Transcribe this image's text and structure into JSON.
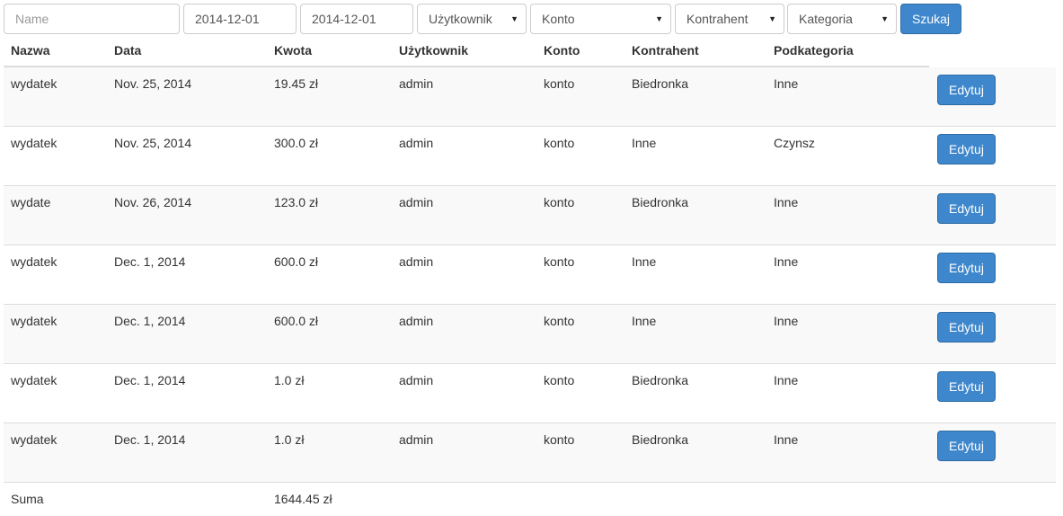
{
  "filters": {
    "name_placeholder": "Name",
    "date_from": "2014-12-01",
    "date_to": "2014-12-01",
    "user_select": "Użytkownik",
    "account_select": "Konto",
    "contractor_select": "Kontrahent",
    "category_select": "Kategoria",
    "search_label": "Szukaj"
  },
  "table": {
    "headers": [
      "Nazwa",
      "Data",
      "Kwota",
      "Użytkownik",
      "Konto",
      "Kontrahent",
      "Podkategoria"
    ],
    "edit_label": "Edytuj",
    "rows": [
      {
        "nazwa": "wydatek",
        "data": "Nov. 25, 2014",
        "kwota": "19.45 zł",
        "uzytkownik": "admin",
        "konto": "konto",
        "kontrahent": "Biedronka",
        "podkategoria": "Inne"
      },
      {
        "nazwa": "wydatek",
        "data": "Nov. 25, 2014",
        "kwota": "300.0 zł",
        "uzytkownik": "admin",
        "konto": "konto",
        "kontrahent": "Inne",
        "podkategoria": "Czynsz"
      },
      {
        "nazwa": "wydate",
        "data": "Nov. 26, 2014",
        "kwota": "123.0 zł",
        "uzytkownik": "admin",
        "konto": "konto",
        "kontrahent": "Biedronka",
        "podkategoria": "Inne"
      },
      {
        "nazwa": "wydatek",
        "data": "Dec. 1, 2014",
        "kwota": "600.0 zł",
        "uzytkownik": "admin",
        "konto": "konto",
        "kontrahent": "Inne",
        "podkategoria": "Inne"
      },
      {
        "nazwa": "wydatek",
        "data": "Dec. 1, 2014",
        "kwota": "600.0 zł",
        "uzytkownik": "admin",
        "konto": "konto",
        "kontrahent": "Inne",
        "podkategoria": "Inne"
      },
      {
        "nazwa": "wydatek",
        "data": "Dec. 1, 2014",
        "kwota": "1.0 zł",
        "uzytkownik": "admin",
        "konto": "konto",
        "kontrahent": "Biedronka",
        "podkategoria": "Inne"
      },
      {
        "nazwa": "wydatek",
        "data": "Dec. 1, 2014",
        "kwota": "1.0 zł",
        "uzytkownik": "admin",
        "konto": "konto",
        "kontrahent": "Biedronka",
        "podkategoria": "Inne"
      }
    ],
    "summary": {
      "label": "Suma",
      "total": "1644.45 zł"
    }
  },
  "colors": {
    "primary_button": "#3f87cc",
    "stripe": "#f9f9f9",
    "border": "#dddddd"
  },
  "icons": {
    "select_caret": "caret-down-icon"
  }
}
